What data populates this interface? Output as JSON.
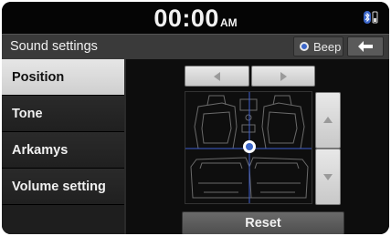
{
  "status": {
    "time": "00:00",
    "ampm": "AM",
    "bluetooth_icon": "bluetooth-icon",
    "phone_icon": "phone-signal-icon"
  },
  "header": {
    "title": "Sound settings",
    "beep_label": "Beep",
    "beep_selected": true,
    "back_icon": "back-arrow-icon"
  },
  "sidebar": {
    "items": [
      {
        "label": "Position",
        "active": true
      },
      {
        "label": "Tone",
        "active": false
      },
      {
        "label": "Arkamys",
        "active": false
      },
      {
        "label": "Volume setting",
        "active": false
      }
    ]
  },
  "position": {
    "left_icon": "triangle-left-icon",
    "right_icon": "triangle-right-icon",
    "up_icon": "triangle-up-icon",
    "down_icon": "triangle-down-icon",
    "reset_label": "Reset"
  },
  "colors": {
    "accent": "#3b66c9",
    "crosshair": "#3d5fd0",
    "active_menu": "#dcdcdc"
  }
}
